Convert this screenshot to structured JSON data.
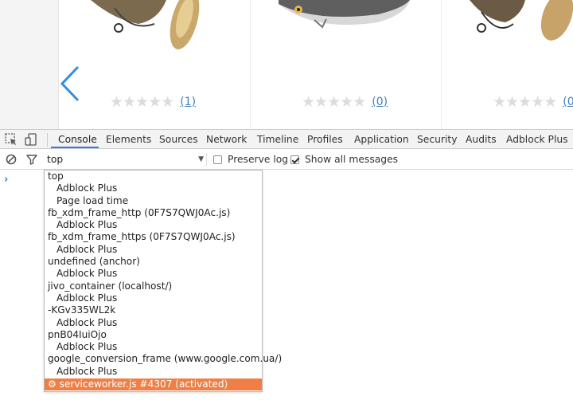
{
  "page": {
    "products": [
      {
        "rating_count": "(1)"
      },
      {
        "rating_count": "(0)"
      },
      {
        "rating_count": "(0)"
      }
    ]
  },
  "devtools": {
    "tabs": [
      {
        "label": "Console",
        "active": true
      },
      {
        "label": "Elements"
      },
      {
        "label": "Sources"
      },
      {
        "label": "Network"
      },
      {
        "label": "Timeline"
      },
      {
        "label": "Profiles"
      },
      {
        "label": "Application"
      },
      {
        "label": "Security"
      },
      {
        "label": "Audits"
      },
      {
        "label": "Adblock Plus"
      }
    ],
    "toolbar": {
      "context_value": "top",
      "preserve_log_label": "Preserve log",
      "preserve_log_checked": false,
      "show_all_label": "Show all messages",
      "show_all_checked": true
    },
    "prompt_symbol": "›",
    "context_menu": {
      "items": [
        {
          "label": "top",
          "level": 0
        },
        {
          "label": "Adblock Plus",
          "level": 1
        },
        {
          "label": "Page load time",
          "level": 1
        },
        {
          "label": "fb_xdm_frame_http (0F7S7QWJ0Ac.js)",
          "level": 0
        },
        {
          "label": "Adblock Plus",
          "level": 1
        },
        {
          "label": "fb_xdm_frame_https (0F7S7QWJ0Ac.js)",
          "level": 0
        },
        {
          "label": "Adblock Plus",
          "level": 1
        },
        {
          "label": "undefined (anchor)",
          "level": 0
        },
        {
          "label": "Adblock Plus",
          "level": 1
        },
        {
          "label": "jivo_container (localhost/)",
          "level": 0
        },
        {
          "label": "Adblock Plus",
          "level": 1
        },
        {
          "label": "-KGv335WL2k",
          "level": 0
        },
        {
          "label": "Adblock Plus",
          "level": 1
        },
        {
          "label": "pnB04IuiOjo",
          "level": 0
        },
        {
          "label": "Adblock Plus",
          "level": 1
        },
        {
          "label": "google_conversion_frame (www.google.com.ua/)",
          "level": 0
        },
        {
          "label": "Adblock Plus",
          "level": 1
        },
        {
          "label": "⚙ serviceworker.js #4307 (activated)",
          "level": 0,
          "selected": true
        }
      ]
    },
    "colors": {
      "accent": "#3879d9",
      "selected_bg": "#ef7f45"
    }
  }
}
